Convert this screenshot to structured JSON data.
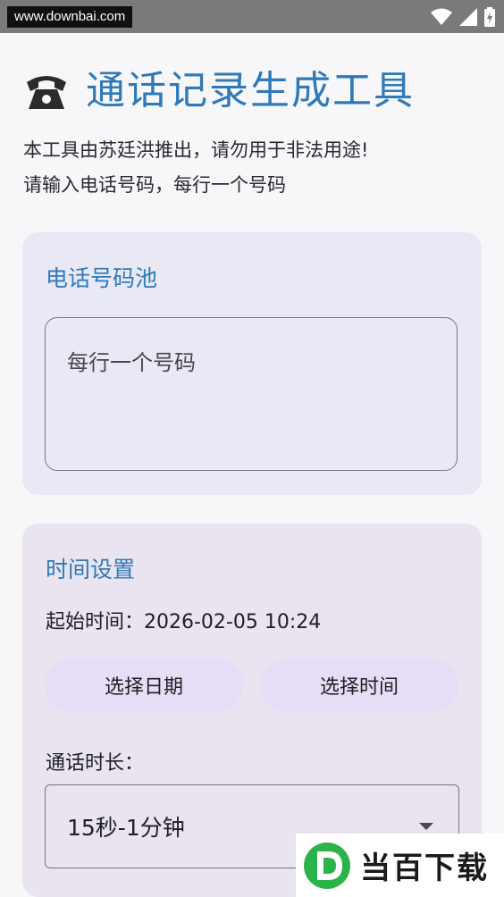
{
  "status_bar": {
    "watermark": "www.downbai.com",
    "icons": [
      "wifi-icon",
      "signal-icon",
      "battery-charging-icon"
    ]
  },
  "header": {
    "icon": "telephone-icon",
    "title": "通话记录生成工具"
  },
  "description": {
    "line1": "本工具由苏廷洪推出，请勿用于非法用途!",
    "line2": "请输入电话号码，每行一个号码"
  },
  "phone_pool": {
    "title": "电话号码池",
    "placeholder": "每行一个号码"
  },
  "time_settings": {
    "title": "时间设置",
    "start_time_label": "起始时间：2026-02-05 10:24",
    "select_date_button": "选择日期",
    "select_time_button": "选择时间",
    "duration_label": "通话时长：",
    "duration_selected": "15秒-1分钟"
  },
  "bottom_watermark": {
    "text": "当百下载"
  },
  "colors": {
    "accent": "#2f79b9",
    "card_phone_bg": "#e8e9f5",
    "card_time_bg": "#e9e4ef",
    "pill_bg": "#e7ddf6",
    "logo_green": "#2bb34a"
  }
}
